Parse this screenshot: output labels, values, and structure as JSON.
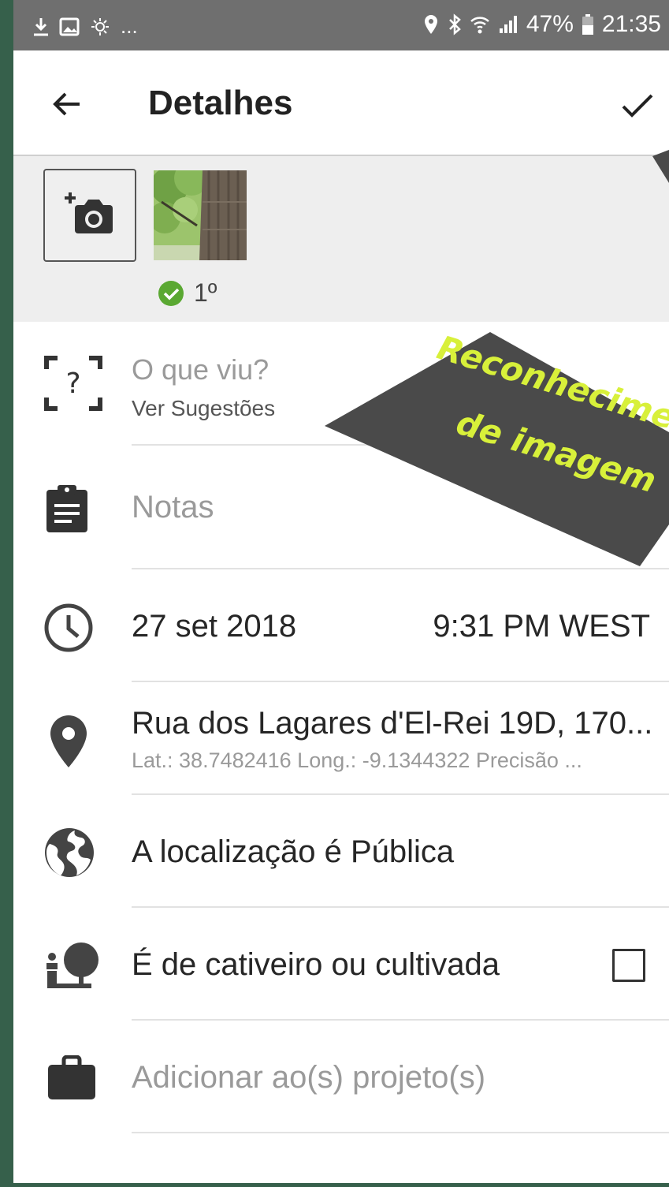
{
  "status_bar": {
    "battery": "47%",
    "time": "21:35",
    "more": "..."
  },
  "toolbar": {
    "title": "Detalhes"
  },
  "photos": {
    "badge": "1º"
  },
  "identify": {
    "placeholder": "O que viu?",
    "suggestions": "Ver Sugestões"
  },
  "notes": {
    "placeholder": "Notas"
  },
  "datetime": {
    "date": "27 set 2018",
    "time": "9:31 PM WEST"
  },
  "location": {
    "address": "Rua dos Lagares d'El-Rei 19D, 170...",
    "coords": "Lat.: 38.7482416 Long.: -9.1344322 Precisão ..."
  },
  "privacy": {
    "label": "A localização é Pública"
  },
  "captive": {
    "label": "É de cativeiro ou cultivada",
    "checked": false
  },
  "projects": {
    "placeholder": "Adicionar ao(s) projeto(s)"
  },
  "annotation": {
    "line1": "Reconhecimento",
    "line2": "de imagem"
  },
  "colors": {
    "accent_green": "#5aa832",
    "background": "#36604b",
    "annotation_text": "#d8f03a",
    "annotation_fill": "#4a4a4a"
  }
}
